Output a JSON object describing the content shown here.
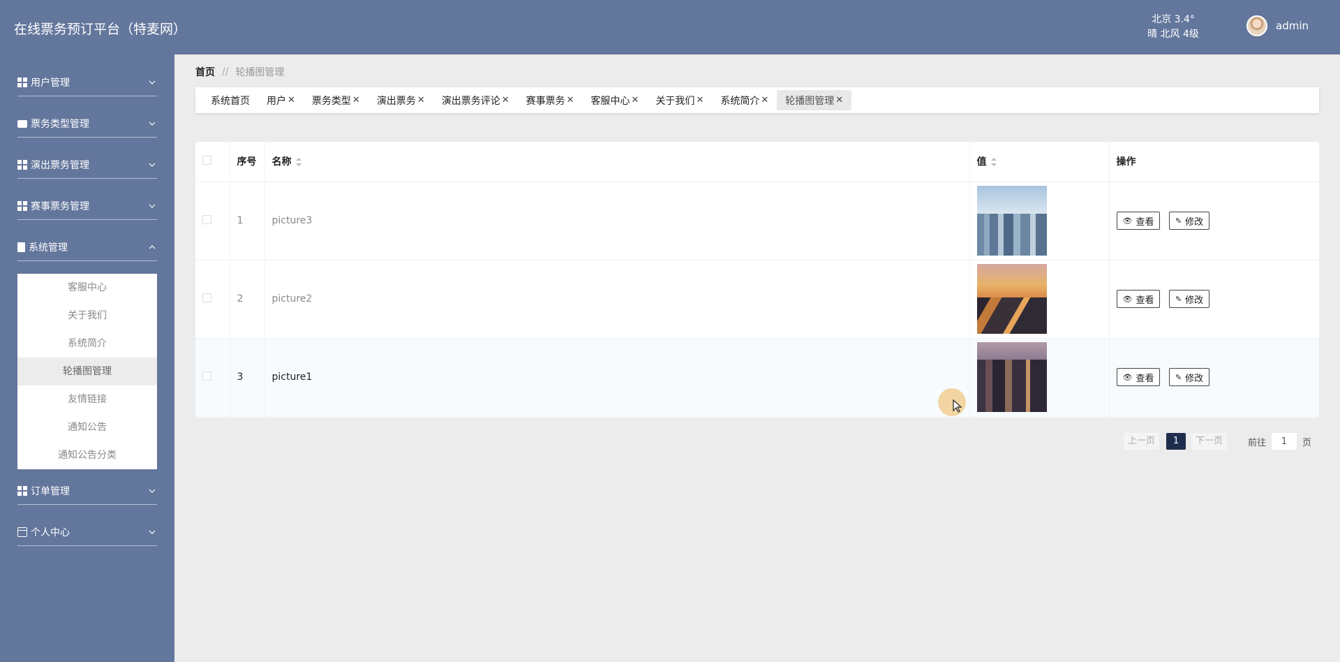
{
  "header": {
    "title": "在线票务预订平台（特麦网）",
    "weather_line1": "北京 3.4°",
    "weather_line2": "晴 北风 4级",
    "username": "admin"
  },
  "sidebar": {
    "menus": [
      {
        "label": "用户管理",
        "icon": "grid-icon",
        "expanded": false
      },
      {
        "label": "票务类型管理",
        "icon": "briefcase-icon",
        "expanded": false
      },
      {
        "label": "演出票务管理",
        "icon": "grid-icon",
        "expanded": false
      },
      {
        "label": "赛事票务管理",
        "icon": "grid-icon",
        "expanded": false
      },
      {
        "label": "系统管理",
        "icon": "clipboard-icon",
        "expanded": true
      },
      {
        "label": "订单管理",
        "icon": "grid-icon",
        "expanded": false
      },
      {
        "label": "个人中心",
        "icon": "card-icon",
        "expanded": false
      }
    ],
    "system_submenu": [
      "客服中心",
      "关于我们",
      "系统简介",
      "轮播图管理",
      "友情链接",
      "通知公告",
      "通知公告分类"
    ],
    "active_submenu": "轮播图管理"
  },
  "breadcrumb": {
    "home": "首页",
    "separator": "//",
    "current": "轮播图管理"
  },
  "tabs": [
    {
      "label": "系统首页",
      "closable": false
    },
    {
      "label": "用户",
      "closable": true
    },
    {
      "label": "票务类型",
      "closable": true
    },
    {
      "label": "演出票务",
      "closable": true
    },
    {
      "label": "演出票务评论",
      "closable": true
    },
    {
      "label": "赛事票务",
      "closable": true
    },
    {
      "label": "客服中心",
      "closable": true
    },
    {
      "label": "关于我们",
      "closable": true
    },
    {
      "label": "系统简介",
      "closable": true
    },
    {
      "label": "轮播图管理",
      "closable": true,
      "active": true
    }
  ],
  "table": {
    "columns": {
      "index": "序号",
      "name": "名称",
      "value": "值",
      "actions": "操作"
    },
    "rows": [
      {
        "index": "1",
        "name": "picture3"
      },
      {
        "index": "2",
        "name": "picture2"
      },
      {
        "index": "3",
        "name": "picture1"
      }
    ],
    "view_label": "查看",
    "edit_label": "修改"
  },
  "pagination": {
    "prev": "上一页",
    "current": "1",
    "next": "下一页",
    "goto_label": "前往",
    "goto_value": "1",
    "unit": "页"
  },
  "colors": {
    "header_bg": "#63769c",
    "active_page": "#1f2d4d",
    "content_bg": "#ececec"
  }
}
